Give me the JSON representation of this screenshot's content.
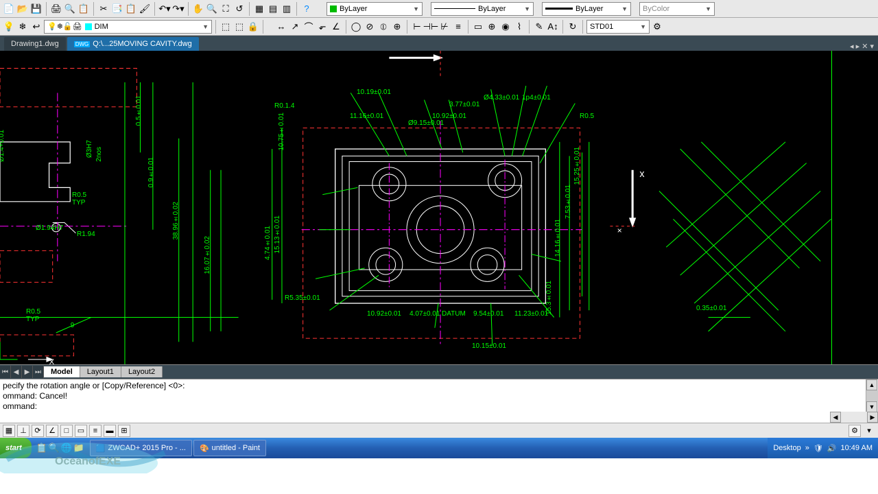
{
  "toolbar1": {
    "layer_dd": "ByLayer",
    "linetype_dd": "ByLayer",
    "lineweight_dd": "ByLayer",
    "color_dd": "ByColor"
  },
  "toolbar2": {
    "layer_state": "DIM",
    "dimstyle": "STD01"
  },
  "file_tabs": {
    "tab1": "Drawing1.dwg",
    "tab2": "Q:\\...25MOVING CAVITY.dwg"
  },
  "model_tabs": {
    "model": "Model",
    "l1": "Layout1",
    "l2": "Layout2"
  },
  "command": {
    "line1": "pecify the rotation angle or [Copy/Reference] <0>:",
    "line2": "ommand: Cancel!",
    "line3": "",
    "prompt": "ommand:"
  },
  "taskbar": {
    "start": "start",
    "app1": "ZWCAD+ 2015 Pro - ...",
    "app2": "untitled - Paint",
    "desktop": "Desktop",
    "time": "10:49 AM"
  },
  "watermark": "OceanofEXE",
  "dims": {
    "d1": "0.5±0.01",
    "d2": "0.9±0.01",
    "d3": "38.96±0.02",
    "d4": "16.07±0.02",
    "d5": "R0.5",
    "d5b": "TYP",
    "d6": "Ø1.94H7",
    "d7": "R1.94",
    "d8": "R0.5",
    "d8b": "TYP",
    "d9": "Ø3H7",
    "d9b": "2nos",
    "d10": "Ø1.4+0.01",
    "d11": "R0.1.4",
    "d12": "10.19±0.01",
    "d13": "11.16±0.01",
    "d14": "Ø9.15±0.01",
    "d15": "10.92±0.01",
    "d16": "3.77±0.01",
    "d17": "Ø4.33±0.01",
    "d18": "1p4±0.01",
    "d19": "R0.5",
    "d20": "10.75±0.01",
    "d21": "4.74±0.01",
    "d22": "15.13±0.01",
    "d23": "R5.35±0.01",
    "d24": "10.92±0.01",
    "d25": "4.07±0.01",
    "d26": "DATUM",
    "d27": "9.54±0.01",
    "d28": "11.23±0.01",
    "d29": "15.25±0.01",
    "d30": "7.53±0.01",
    "d31": "14.16±0.01",
    "d32": "15.3±0.01",
    "d33": "10.15±0.01",
    "d34": "0.35±0.01",
    "d35": ".9"
  }
}
